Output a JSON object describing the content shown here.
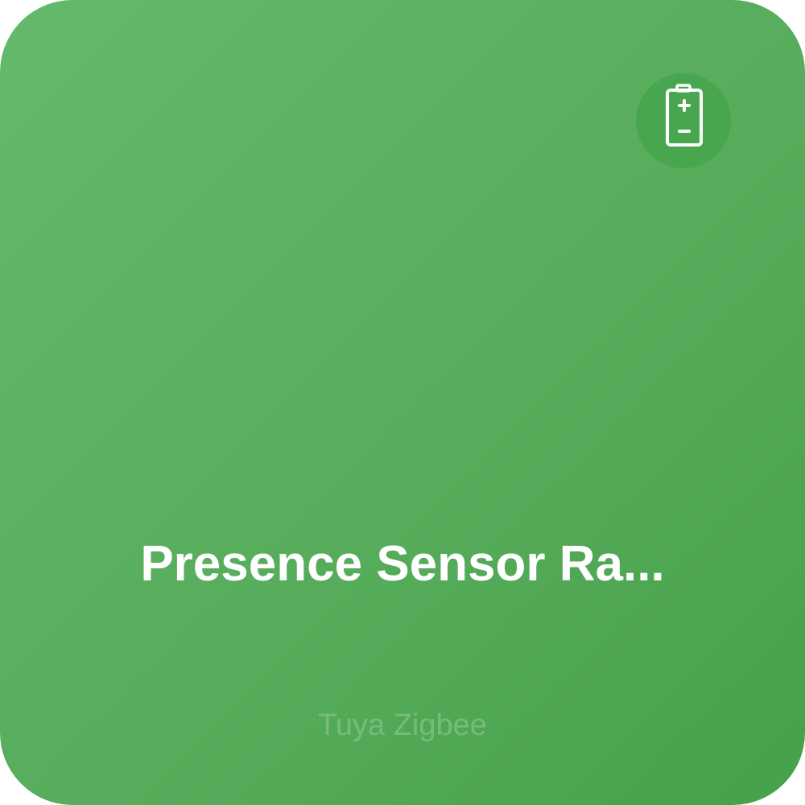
{
  "tile": {
    "title": "Presence Sensor Ra...",
    "subtitle": "Tuya Zigbee",
    "colors": {
      "background_start": "#64b96a",
      "background_end": "#46a14b",
      "badge": "#4fae55",
      "text": "#ffffff"
    }
  },
  "badge": {
    "icon": "battery-icon"
  }
}
